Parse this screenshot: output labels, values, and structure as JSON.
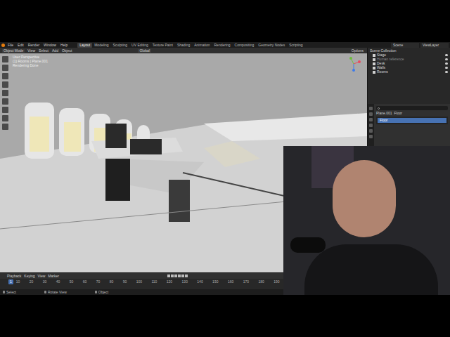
{
  "topbar": {
    "menus": [
      "File",
      "Edit",
      "Render",
      "Window",
      "Help"
    ],
    "workspaces": [
      {
        "label": "Layout",
        "selected": true
      },
      {
        "label": "Modeling",
        "selected": false
      },
      {
        "label": "Sculpting",
        "selected": false
      },
      {
        "label": "UV Editing",
        "selected": false
      },
      {
        "label": "Texture Paint",
        "selected": false
      },
      {
        "label": "Shading",
        "selected": false
      },
      {
        "label": "Animation",
        "selected": false
      },
      {
        "label": "Rendering",
        "selected": false
      },
      {
        "label": "Compositing",
        "selected": false
      },
      {
        "label": "Geometry Nodes",
        "selected": false
      },
      {
        "label": "Scripting",
        "selected": false
      }
    ],
    "scene": "Scene",
    "view_layer": "ViewLayer"
  },
  "viewport_header": {
    "mode": "Object Mode",
    "menus": [
      "View",
      "Select",
      "Add",
      "Object"
    ],
    "orientation": "Global",
    "options": "Options"
  },
  "viewport": {
    "overlay_lines": [
      "User Perspective",
      "(1) Rooms | Plane.001",
      "Rendering Done"
    ]
  },
  "outliner": {
    "root": "Scene Collection",
    "items": [
      {
        "label": "Stage",
        "disabled": false
      },
      {
        "label": "Human reference",
        "disabled": true
      },
      {
        "label": "Desk",
        "disabled": false
      },
      {
        "label": "Walls",
        "disabled": false
      },
      {
        "label": "Rooms",
        "disabled": false
      }
    ]
  },
  "properties": {
    "breadcrumb": [
      "Plane.001",
      "Floor"
    ],
    "slots": [
      {
        "label": "Floor",
        "selected": true
      }
    ]
  },
  "timeline": {
    "menus": [
      "Playback",
      "Keying",
      "View",
      "Marker"
    ],
    "current_frame": "1",
    "ticks": [
      "10",
      "20",
      "30",
      "40",
      "50",
      "60",
      "70",
      "80",
      "90",
      "100",
      "110",
      "120",
      "130",
      "140",
      "150",
      "160",
      "170",
      "180",
      "190"
    ]
  },
  "status_bar": [
    "Select",
    "Rotate View",
    "Object"
  ]
}
